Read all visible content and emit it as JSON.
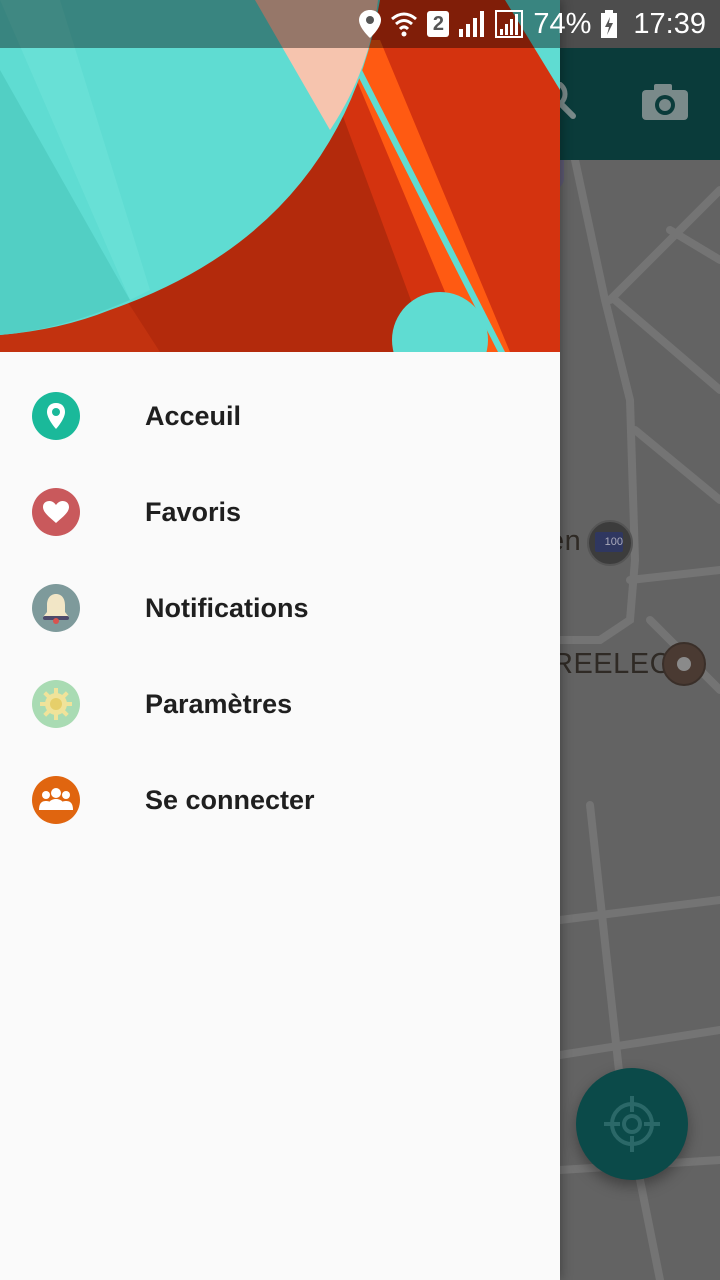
{
  "status_bar": {
    "battery": "74%",
    "time": "17:39",
    "sim_badge": "2",
    "icons": [
      "location-icon",
      "wifi-icon",
      "sim2-icon",
      "signal-icon",
      "signal-icon",
      "battery-charging-icon"
    ]
  },
  "drawer": {
    "items": [
      {
        "label": "Acceuil",
        "icon": "map-pin-icon",
        "color": "#1ab99a"
      },
      {
        "label": "Favoris",
        "icon": "heart-icon",
        "color": "#c9595c"
      },
      {
        "label": "Notifications",
        "icon": "bell-icon",
        "color": "#7e9a9b"
      },
      {
        "label": "Paramètres",
        "icon": "gear-icon",
        "color": "#a9dbb3"
      },
      {
        "label": "Se connecter",
        "icon": "group-icon",
        "color": "#e0650f"
      }
    ]
  },
  "map": {
    "labels": [
      "en",
      "REELEC"
    ],
    "poi_badge": "100",
    "toolbar_icons": [
      "search-icon",
      "camera-icon"
    ],
    "fab_icon": "crosshair-icon"
  },
  "colors": {
    "accent_teal": "#0b4a49",
    "drawer_bg": "#fafafa",
    "header_teal": "#5fdcd2",
    "header_red": "#d4330f",
    "header_orange": "#ff5a12"
  }
}
